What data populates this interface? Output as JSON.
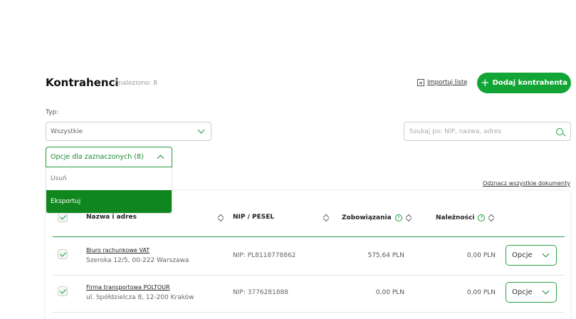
{
  "header": {
    "title": "Kontrahenci",
    "found": "Znaleziono: 8",
    "import_label": "Importuj listę",
    "add_label": "Dodaj kontrahenta"
  },
  "filters": {
    "type_label": "Typ:",
    "type_value": "Wszystkie",
    "search_placeholder": "Szukaj po: NIP, nazwa, adres"
  },
  "bulk": {
    "button_label": "Opcje dla zaznaczonych (8)",
    "items": [
      "Usuń",
      "Eksportuj"
    ],
    "active_index": 1,
    "uncheck_all": "Odznacz wszystkie dokumenty"
  },
  "table": {
    "columns": [
      "Nazwa i adres",
      "NIP / PESEL",
      "Zobowiązania",
      "Należności"
    ],
    "options_label": "Opcje",
    "rows": [
      {
        "name": "Biuro rachunkowe VAT",
        "address": "Szeroka 12/5, 00-222 Warszawa",
        "nip": "NIP: PL8118778862",
        "liabilities": "575,64 PLN",
        "receivables": "0,00 PLN"
      },
      {
        "name": "Firma transportowa POLTOUR",
        "address": "ul. Spółdzielcza 8, 12-200 Kraków",
        "nip": "NIP: 3776281888",
        "liabilities": "0,00 PLN",
        "receivables": "0,00 PLN"
      }
    ]
  },
  "colors": {
    "accent": "#12a536",
    "active_item": "#10861f"
  }
}
